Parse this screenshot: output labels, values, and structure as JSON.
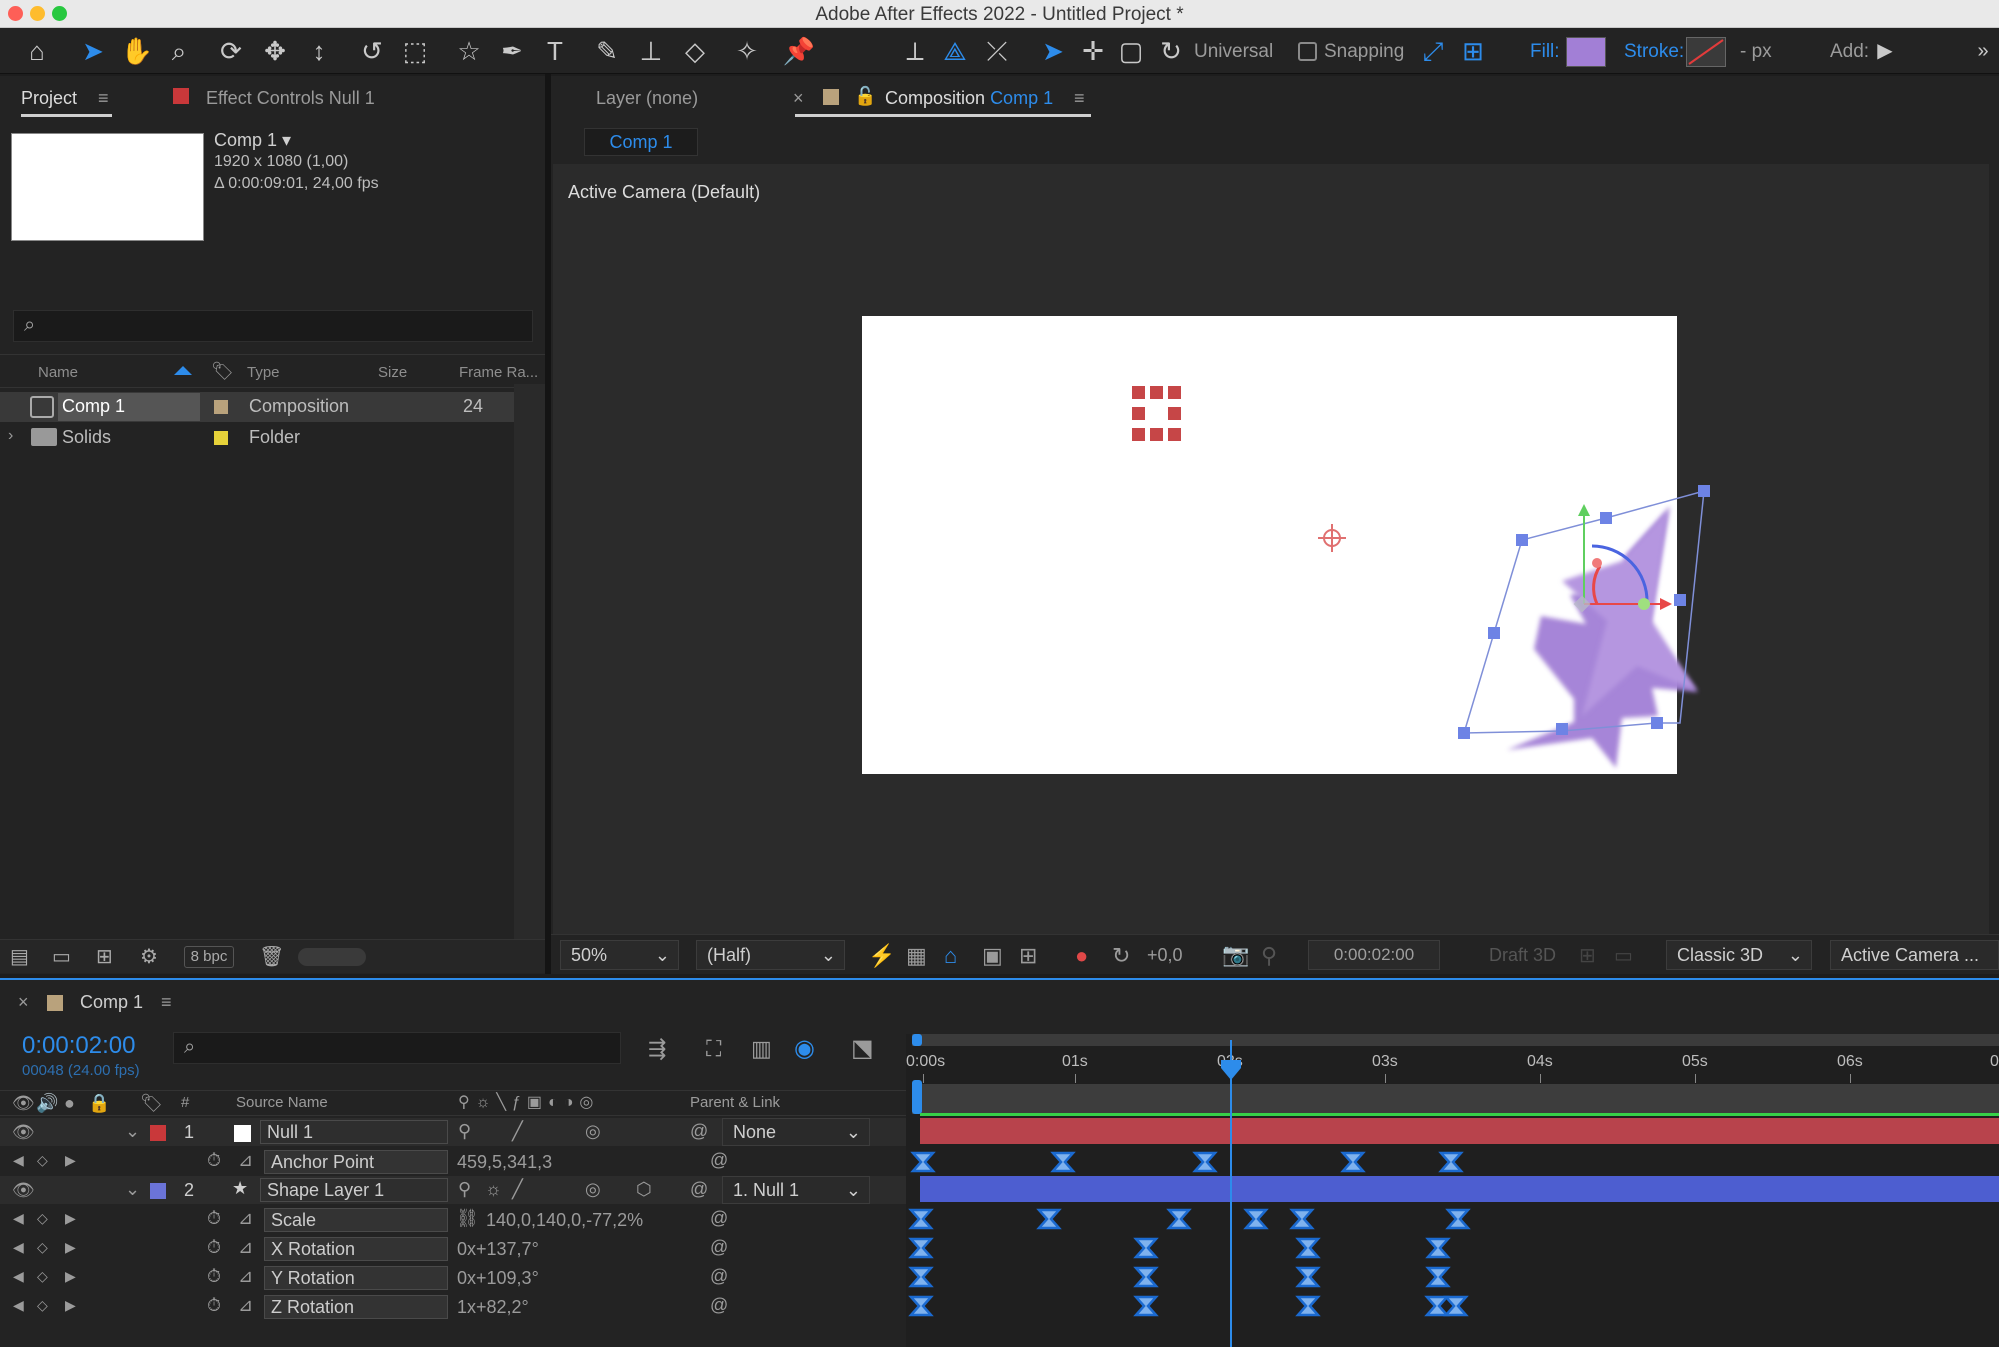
{
  "window": {
    "title": "Adobe After Effects 2022 - Untitled Project *"
  },
  "toolbar": {
    "universal": "Universal",
    "snapping": "Snapping",
    "fill": "Fill:",
    "stroke": "Stroke:",
    "stroke_units": "- px",
    "add": "Add:",
    "fill_color": "#a27fd6",
    "accent": "#2d8ceb"
  },
  "project": {
    "tab": "Project",
    "effect_tab": "Effect Controls Null 1",
    "comp_name": "Comp 1 ▾",
    "comp_res": "1920 x 1080 (1,00)",
    "comp_dur": "Δ 0:00:09:01, 24,00 fps",
    "columns": {
      "name": "Name",
      "type": "Type",
      "size": "Size",
      "frame_rate": "Frame Ra..."
    },
    "items": [
      {
        "name": "Comp 1",
        "type": "Composition",
        "frame_rate": "24",
        "label_color": "#b9a27c"
      },
      {
        "name": "Solids",
        "type": "Folder",
        "frame_rate": "",
        "label_color": "#e6d23a"
      }
    ],
    "bpc": "8 bpc"
  },
  "viewer": {
    "layer_tab": "Layer (none)",
    "comp_tab_prefix": "Composition",
    "comp_tab_name": "Comp 1",
    "comp_chip": "Comp 1",
    "camera_label": "Active Camera (Default)",
    "zoom": "50%",
    "resolution": "(Half)",
    "exposure": "+0,0",
    "timecode": "0:00:02:00",
    "draft3d": "Draft 3D",
    "renderer": "Classic 3D",
    "view": "Active Camera ...",
    "shape_fill": "#a27fd6"
  },
  "timeline": {
    "tab": "Comp 1",
    "timecode": "0:00:02:00",
    "frames": "00048 (24.00 fps)",
    "ruler": [
      "0:00s",
      "01s",
      "02s",
      "03s",
      "04s",
      "05s",
      "06s"
    ],
    "headers": {
      "num": "#",
      "source": "Source Name",
      "parent": "Parent & Link"
    },
    "layers": [
      {
        "num": "1",
        "name": "Null 1",
        "parent": "None",
        "label_color": "#c9383a",
        "bar_color": "#b8434c"
      },
      {
        "num": "2",
        "name": "Shape Layer 1",
        "parent": "1. Null 1",
        "label_color": "#6b74d8",
        "bar_color": "#4d5ed0"
      }
    ],
    "properties": [
      {
        "name": "Anchor Point",
        "value": "459,5,341,3"
      },
      {
        "name": "Scale",
        "value": "140,0,140,0,-77,2%"
      },
      {
        "name": "X Rotation",
        "value": "0x+137,7°"
      },
      {
        "name": "Y Rotation",
        "value": "0x+109,3°"
      },
      {
        "name": "Z Rotation",
        "value": "1x+82,2°"
      }
    ]
  }
}
